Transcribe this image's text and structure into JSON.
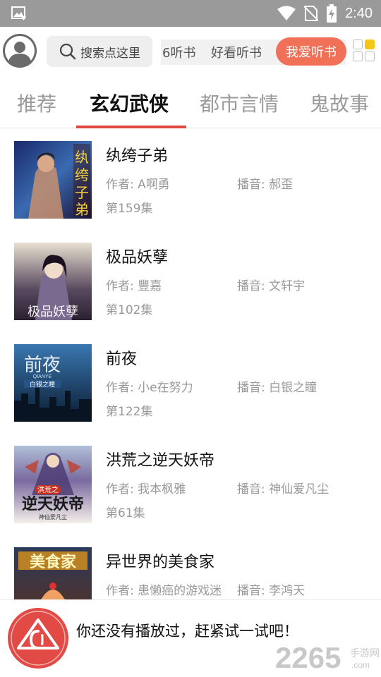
{
  "status_bar": {
    "time": "2:40",
    "icons": [
      "image-notification-icon",
      "wifi-icon",
      "no-sim-icon",
      "battery-charging-icon"
    ]
  },
  "header": {
    "avatar_icon": "user-avatar-icon",
    "search": {
      "label": "搜索点这里",
      "icon": "search-icon"
    },
    "quick_links": [
      "6听书",
      "好看听书",
      "我爱听书"
    ],
    "active_quick_link_color": "#f07058",
    "grid_icon": "apps-grid-icon"
  },
  "tabs": {
    "items": [
      "推荐",
      "玄幻武侠",
      "都市言情",
      "鬼故事"
    ],
    "active_index": 1,
    "indicator_color": "#e0473e"
  },
  "books": [
    {
      "title": "纨绔子弟",
      "author_label": "作者: A啊勇",
      "narrator_label": "播音: 郝歪",
      "episode": "第159集",
      "cover_text": "纨绔子弟"
    },
    {
      "title": "极品妖孽",
      "author_label": "作者: 豐嘉",
      "narrator_label": "播音: 文轩宇",
      "episode": "第102集",
      "cover_text": "极品妖孽"
    },
    {
      "title": "前夜",
      "author_label": "作者: 小e在努力",
      "narrator_label": "播音: 白银之瞳",
      "episode": "第122集",
      "cover_text": "前夜",
      "cover_subtext": "QIANYE",
      "cover_author": "白银之瞳"
    },
    {
      "title": "洪荒之逆天妖帝",
      "author_label": "作者: 我本枫雅",
      "narrator_label": "播音: 神仙爱凡尘",
      "episode": "第61集",
      "cover_text": "逆天妖帝",
      "cover_top": "洪荒之",
      "cover_author": "神仙爱凡尘"
    },
    {
      "title": "异世界的美食家",
      "author_label": "作者: 患懒癌的游戏迷",
      "narrator_label": "播音: 李鸿天",
      "episode": "",
      "cover_text": "美食家"
    }
  ],
  "player": {
    "message": "你还没有播放过，赶紧试一试吧！",
    "icon": "player-logo-icon",
    "accent_color": "#e24a45"
  },
  "watermark": {
    "number": "2265",
    "suffix": "手游网",
    "domain": ".com"
  }
}
